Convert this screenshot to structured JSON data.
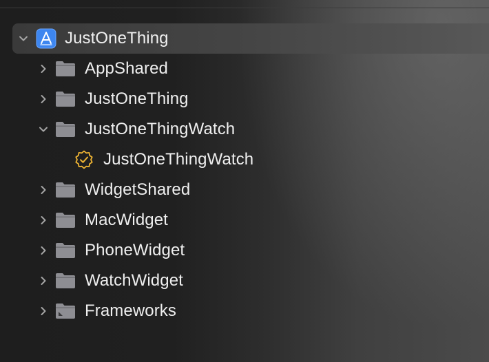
{
  "navigator": {
    "root": {
      "label": "JustOneThing",
      "icon": "xcode-project-icon",
      "expanded": true
    },
    "items": [
      {
        "label": "AppShared",
        "icon": "folder-icon",
        "expanded": false
      },
      {
        "label": "JustOneThing",
        "icon": "folder-icon",
        "expanded": false
      },
      {
        "label": "JustOneThingWatch",
        "icon": "folder-icon",
        "expanded": true
      },
      {
        "label": "JustOneThingWatch",
        "icon": "watch-app-badge-icon"
      },
      {
        "label": "WidgetShared",
        "icon": "folder-icon",
        "expanded": false
      },
      {
        "label": "MacWidget",
        "icon": "folder-icon",
        "expanded": false
      },
      {
        "label": "PhoneWidget",
        "icon": "folder-icon",
        "expanded": false
      },
      {
        "label": "WatchWidget",
        "icon": "folder-icon",
        "expanded": false
      },
      {
        "label": "Frameworks",
        "icon": "frameworks-folder-icon",
        "expanded": false
      }
    ]
  },
  "colors": {
    "folder": "#8e8e93",
    "project_icon": "#3d86f0",
    "badge": "#f0b533",
    "chevron": "#a5a5a5"
  }
}
